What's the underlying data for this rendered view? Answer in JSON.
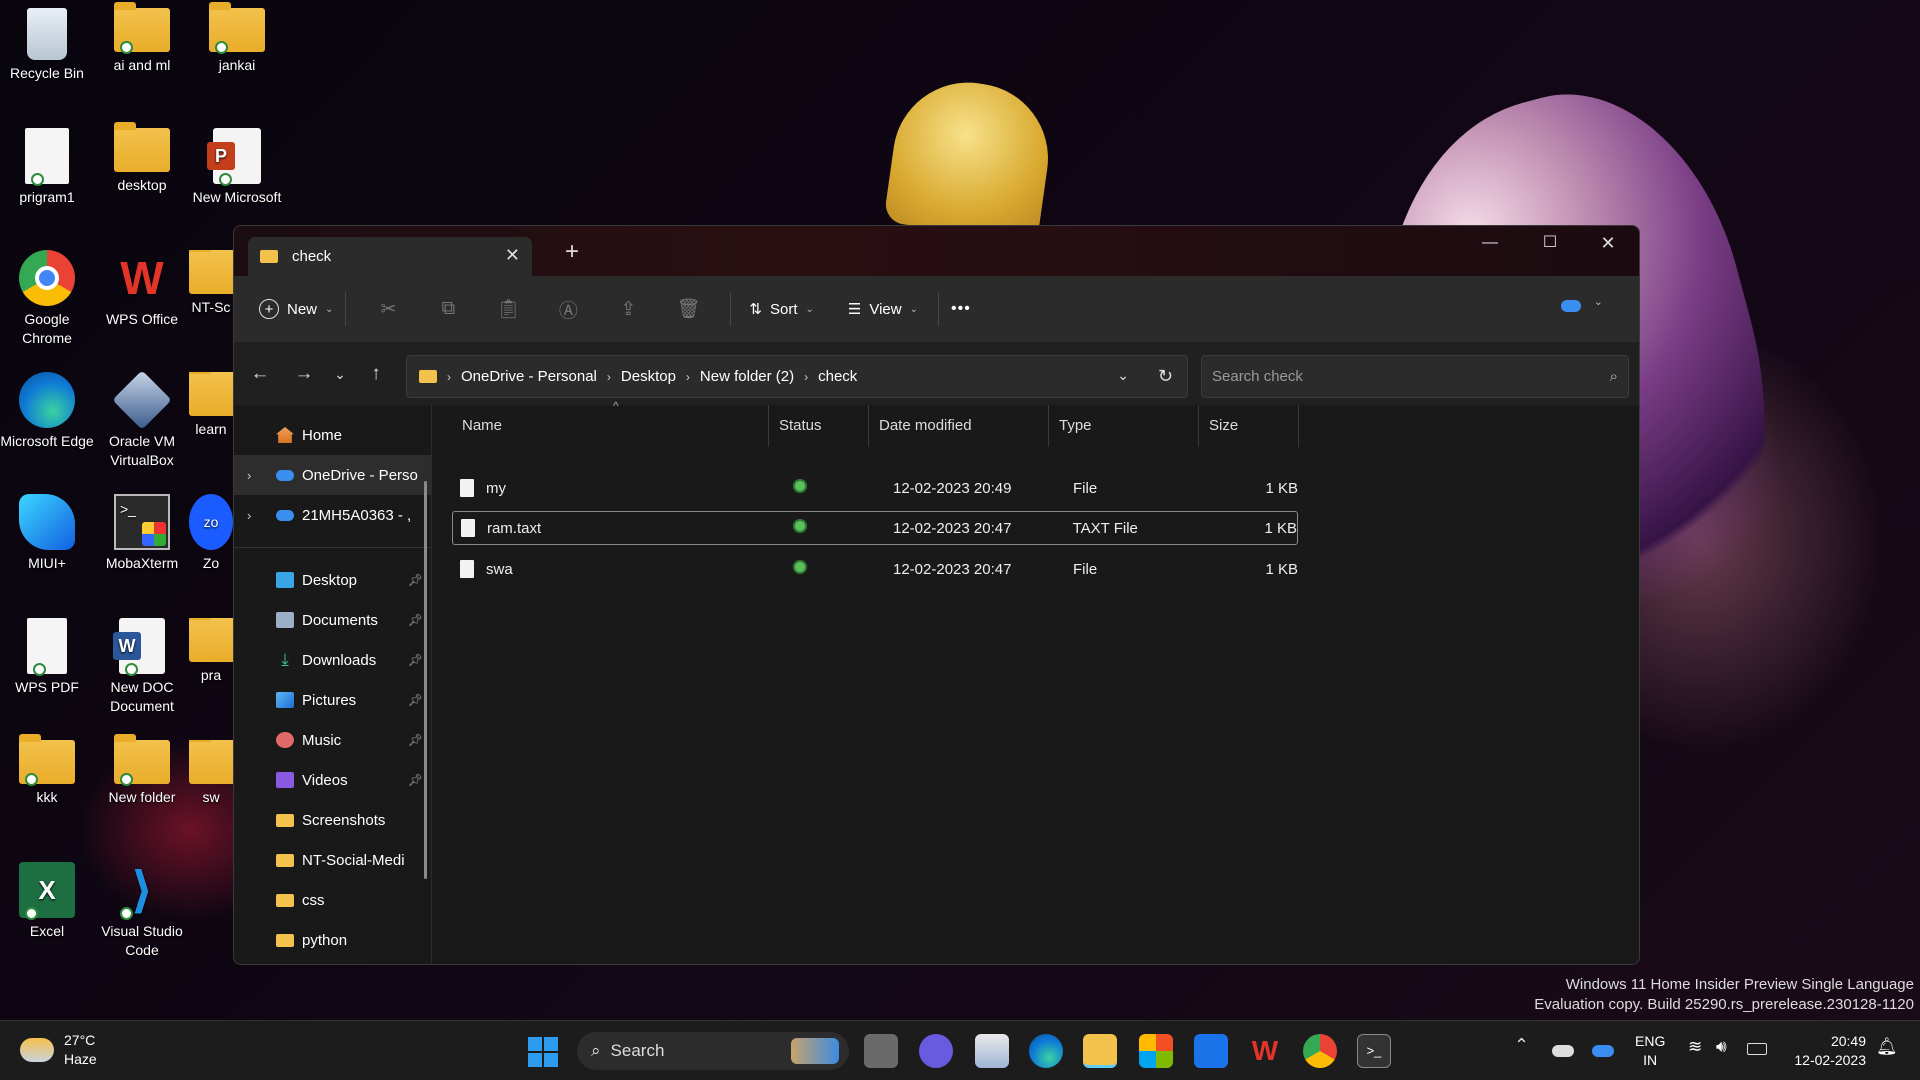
{
  "desktop_icons": [
    {
      "label": "Recycle Bin",
      "kind": "recycle-bin"
    },
    {
      "label": "ai and ml",
      "kind": "folder"
    },
    {
      "label": "jankai",
      "kind": "folder"
    },
    {
      "label": "prigram1",
      "kind": "file"
    },
    {
      "label": "desktop",
      "kind": "folder"
    },
    {
      "label": "New Microsoft",
      "kind": "powerpoint"
    },
    {
      "label": "Google Chrome",
      "kind": "chrome"
    },
    {
      "label": "WPS Office",
      "kind": "wps"
    },
    {
      "label": "NT-Sc",
      "kind": "folder"
    },
    {
      "label": "Microsoft Edge",
      "kind": "edge"
    },
    {
      "label": "Oracle VM VirtualBox",
      "kind": "virtualbox"
    },
    {
      "label": "learn",
      "kind": "folder"
    },
    {
      "label": "MIUI+",
      "kind": "miui"
    },
    {
      "label": "MobaXterm",
      "kind": "mobaxterm"
    },
    {
      "label": "Zo",
      "kind": "zoom"
    },
    {
      "label": "WPS PDF",
      "kind": "file"
    },
    {
      "label": "New DOC Document",
      "kind": "word"
    },
    {
      "label": "pra",
      "kind": "folder"
    },
    {
      "label": "kkk",
      "kind": "folder"
    },
    {
      "label": "New folder",
      "kind": "folder"
    },
    {
      "label": "sw",
      "kind": "folder"
    },
    {
      "label": "Excel",
      "kind": "excel"
    },
    {
      "label": "Visual Studio Code",
      "kind": "vscode"
    }
  ],
  "window": {
    "tab_title": "check",
    "toolbar": {
      "new_label": "New",
      "sort_label": "Sort",
      "view_label": "View",
      "more_label": "•••"
    },
    "breadcrumb": [
      "OneDrive - Personal",
      "Desktop",
      "New folder (2)",
      "check"
    ],
    "search_placeholder": "Search check",
    "nav": {
      "home": "Home",
      "onedrive": "OneDrive - Perso",
      "account": "21MH5A0363 - ,",
      "quick": [
        "Desktop",
        "Documents",
        "Downloads",
        "Pictures",
        "Music",
        "Videos"
      ],
      "folders": [
        "Screenshots",
        "NT-Social-Medi",
        "css",
        "python"
      ]
    },
    "columns": [
      "Name",
      "Status",
      "Date modified",
      "Type",
      "Size"
    ],
    "files": [
      {
        "name": "my",
        "date": "12-02-2023 20:49",
        "type": "File",
        "size": "1 KB"
      },
      {
        "name": "ram.taxt",
        "date": "12-02-2023 20:47",
        "type": "TAXT File",
        "size": "1 KB"
      },
      {
        "name": "swa",
        "date": "12-02-2023 20:47",
        "type": "File",
        "size": "1 KB"
      }
    ]
  },
  "watermark": {
    "line1": "Windows 11 Home Insider Preview Single Language",
    "line2": "Evaluation copy. Build 25290.rs_prerelease.230128-1120"
  },
  "taskbar": {
    "weather_temp": "27°C",
    "weather_desc": "Haze",
    "search_label": "Search",
    "lang_top": "ENG",
    "lang_bottom": "IN",
    "time": "20:49",
    "date": "12-02-2023"
  },
  "colors": {
    "accent": "#0078d4",
    "folder": "#f3c24c",
    "status_ok": "#5cbf5c"
  }
}
